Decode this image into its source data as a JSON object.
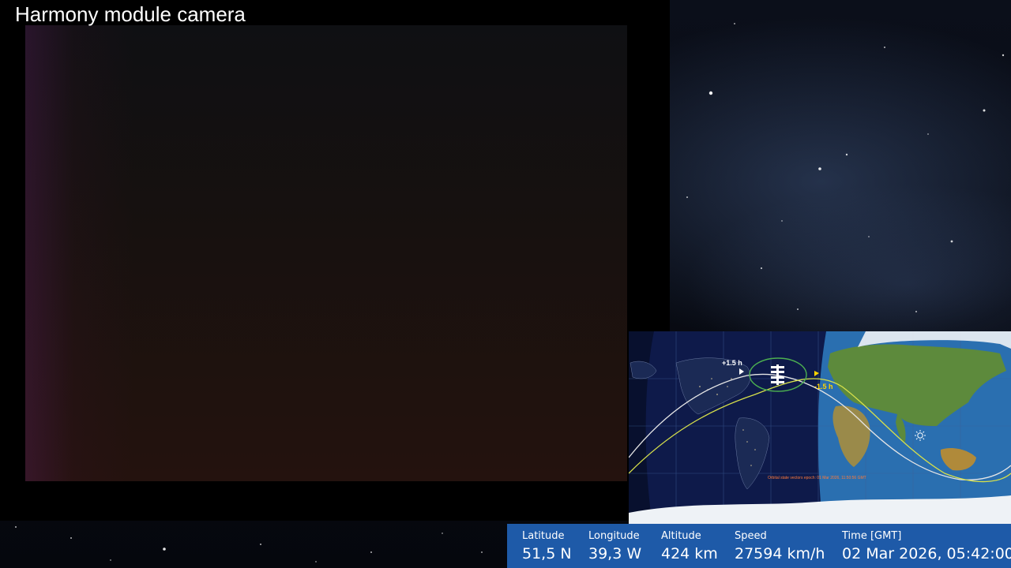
{
  "camera": {
    "title": "Harmony module camera"
  },
  "map": {
    "orbit_plus_label": "+1.5 h",
    "orbit_minus_label": "-1.5 h",
    "note": "Orbital state vectors epoch: 01 Mar 2026, 11:50:56 GMT",
    "colors": {
      "ocean": "#2a6fb0",
      "night": "#0e1a4a",
      "land": "#5d8a3c",
      "past_track": "#e6e6e6",
      "future_track": "#d7e04a",
      "visibility_circle": "#4caf50"
    },
    "icons": [
      "iss-icon",
      "sun-icon"
    ]
  },
  "telemetry": {
    "latitude": {
      "label": "Latitude",
      "value": "51,5 N"
    },
    "longitude": {
      "label": "Longitude",
      "value": "39,3 W"
    },
    "altitude": {
      "label": "Altitude",
      "value": "424 km"
    },
    "speed": {
      "label": "Speed",
      "value": "27594 km/h"
    },
    "time": {
      "label": "Time [GMT]",
      "value": "02 Mar 2026, 05:42:00"
    }
  }
}
